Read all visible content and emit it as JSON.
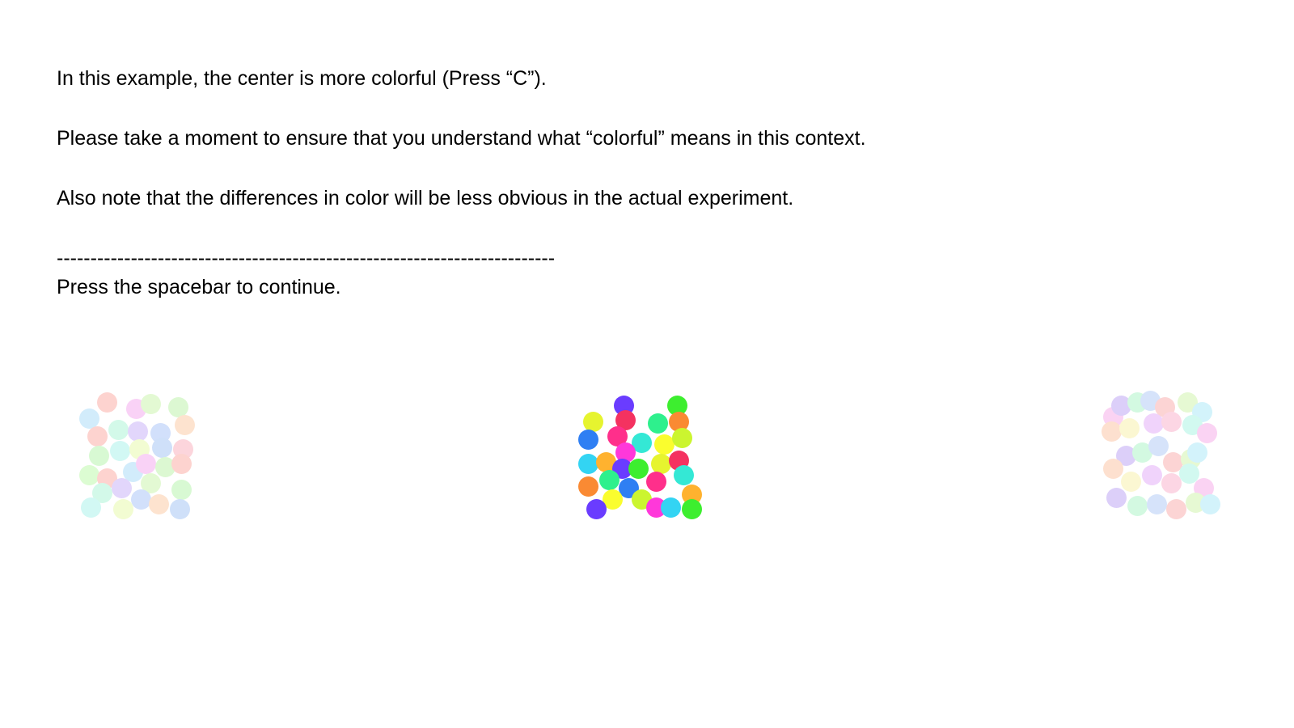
{
  "instructions": {
    "line1": "In this example, the center is more colorful (Press “C”).",
    "line2": "Please take a moment to ensure that you understand what “colorful” means in this context.",
    "line3": "Also note that the differences in color will be less obvious in the actual experiment.",
    "divider": "--------------------------------------------------------------------------",
    "continue": "Press the spacebar to continue."
  },
  "stimuli": {
    "left": {
      "saturation": "low",
      "colors": [
        "#fdd3cf",
        "#d2ecfb",
        "#f9d2f6",
        "#e3f9d3",
        "#dcf8d2",
        "#fdd3cf",
        "#d3f9e9",
        "#e2d6fb",
        "#d2e0fb",
        "#fde3cf",
        "#d8f9d3",
        "#d2f8f4",
        "#f2fcd2",
        "#cfe0f9",
        "#fcd5dc",
        "#dcfcd2"
      ]
    },
    "center": {
      "saturation": "high",
      "colors": [
        "#6a3cff",
        "#3dee2f",
        "#e6f42f",
        "#f43260",
        "#2ef08d",
        "#fa8a33",
        "#2f7ff3",
        "#ff2f8b",
        "#34e8d5",
        "#fafd2e",
        "#cbf52f",
        "#ff38da",
        "#33d4f3",
        "#ffb22f"
      ]
    },
    "right": {
      "saturation": "low",
      "colors": [
        "#fad3f3",
        "#dccff9",
        "#d3f9e1",
        "#d6e3fa",
        "#fcd4d4",
        "#e6f9d3",
        "#d3f3fb",
        "#fde0cf",
        "#fbf7d2",
        "#f0d3fb",
        "#fcd6e4",
        "#d2f9f0"
      ]
    }
  }
}
